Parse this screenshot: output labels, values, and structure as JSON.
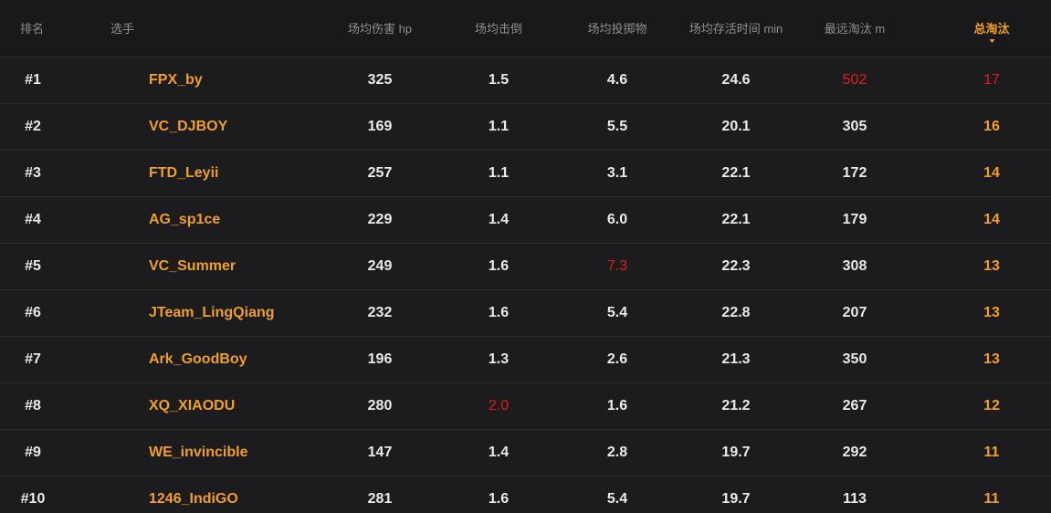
{
  "columns": {
    "rank": "排名",
    "player": "选手",
    "damage": "场均伤害 hp",
    "kills": "场均击倒",
    "throwables": "场均投掷物",
    "survival": "场均存活时间 min",
    "longest": "最远淘汰 m",
    "total": "总淘汰"
  },
  "sorted_column": "total",
  "colors": {
    "accent": "#f0a020",
    "highlight": "#e31b1b",
    "background": "#1b1b1e"
  },
  "rows": [
    {
      "rank": "#1",
      "player": "FPX_by",
      "damage": "325",
      "kills": "1.5",
      "throwables": "4.6",
      "survival": "24.6",
      "longest": "502",
      "total": "17",
      "hl": [
        "longest",
        "total"
      ]
    },
    {
      "rank": "#2",
      "player": "VC_DJBOY",
      "damage": "169",
      "kills": "1.1",
      "throwables": "5.5",
      "survival": "20.1",
      "longest": "305",
      "total": "16",
      "hl": []
    },
    {
      "rank": "#3",
      "player": "FTD_Leyii",
      "damage": "257",
      "kills": "1.1",
      "throwables": "3.1",
      "survival": "22.1",
      "longest": "172",
      "total": "14",
      "hl": []
    },
    {
      "rank": "#4",
      "player": "AG_sp1ce",
      "damage": "229",
      "kills": "1.4",
      "throwables": "6.0",
      "survival": "22.1",
      "longest": "179",
      "total": "14",
      "hl": []
    },
    {
      "rank": "#5",
      "player": "VC_Summer",
      "damage": "249",
      "kills": "1.6",
      "throwables": "7.3",
      "survival": "22.3",
      "longest": "308",
      "total": "13",
      "hl": [
        "throwables"
      ]
    },
    {
      "rank": "#6",
      "player": "JTeam_LingQiang",
      "damage": "232",
      "kills": "1.6",
      "throwables": "5.4",
      "survival": "22.8",
      "longest": "207",
      "total": "13",
      "hl": []
    },
    {
      "rank": "#7",
      "player": "Ark_GoodBoy",
      "damage": "196",
      "kills": "1.3",
      "throwables": "2.6",
      "survival": "21.3",
      "longest": "350",
      "total": "13",
      "hl": []
    },
    {
      "rank": "#8",
      "player": "XQ_XIAODU",
      "damage": "280",
      "kills": "2.0",
      "throwables": "1.6",
      "survival": "21.2",
      "longest": "267",
      "total": "12",
      "hl": [
        "kills"
      ]
    },
    {
      "rank": "#9",
      "player": "WE_invincible",
      "damage": "147",
      "kills": "1.4",
      "throwables": "2.8",
      "survival": "19.7",
      "longest": "292",
      "total": "11",
      "hl": []
    },
    {
      "rank": "#10",
      "player": "1246_IndiGO",
      "damage": "281",
      "kills": "1.6",
      "throwables": "5.4",
      "survival": "19.7",
      "longest": "113",
      "total": "11",
      "hl": []
    }
  ]
}
